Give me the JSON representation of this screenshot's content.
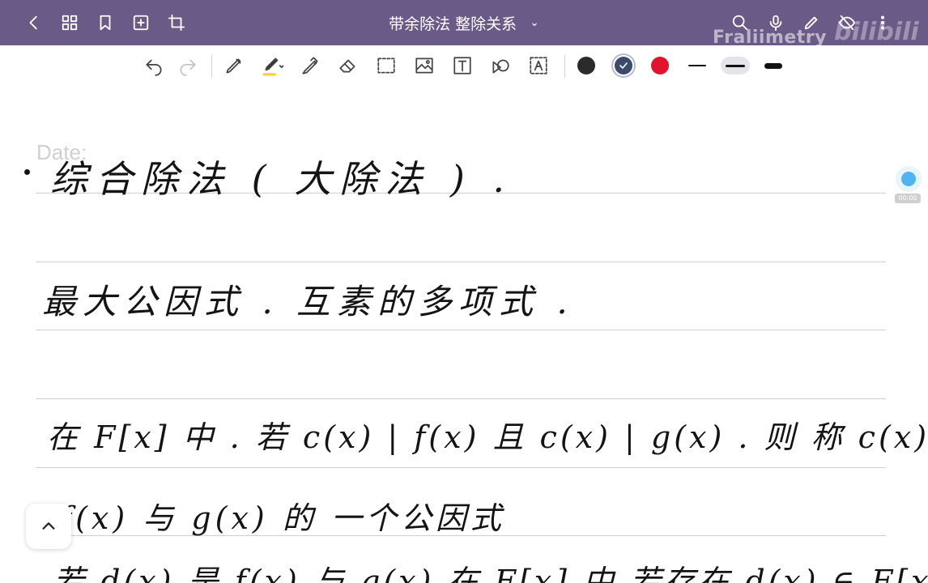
{
  "titlebar": {
    "title": "带余除法 整除关系",
    "chevron": "⌄",
    "watermark": "Fraliimetry",
    "watermark_logo": "bilibili",
    "left_icons": [
      "back-icon",
      "grid-icon",
      "bookmark-icon",
      "add-page-icon",
      "crop-icon"
    ],
    "right_icons": [
      "search-icon",
      "microphone-icon",
      "pen-edit-icon",
      "hide-icon",
      "more-icon"
    ]
  },
  "toolbar": {
    "tools": [
      "undo-icon",
      "redo-icon",
      "pen-icon",
      "highlighter-icon",
      "marker-icon",
      "eraser-icon",
      "lasso-select-icon",
      "image-icon",
      "text-icon",
      "shape-icon",
      "text-recognize-icon"
    ],
    "colors": [
      {
        "name": "black",
        "hex": "#2b2b2b",
        "selected": false
      },
      {
        "name": "navy",
        "hex": "#3b4a6b",
        "selected": true
      },
      {
        "name": "red",
        "hex": "#e0142c",
        "selected": false
      }
    ],
    "stroke_widths": [
      {
        "name": "thin",
        "selected": false
      },
      {
        "name": "medium",
        "selected": true
      },
      {
        "name": "thick",
        "selected": false
      }
    ]
  },
  "note": {
    "date_label": "Date:",
    "lines": [
      {
        "text": "综合除法 ( 大除法 ) ."
      },
      {
        "text": "最大公因式 . 互素的多项式 ."
      },
      {
        "text": "在 F[x] 中 . 若 c(x) | f(x) 且 c(x) | g(x) . 则 称 c(x) 是"
      },
      {
        "text": "f(x) 与 g(x) 的 一个公因式"
      },
      {
        "text": "若 d(x) 是 f(x) 与 g(x) 在 F[x] 中 若存在 d(x) ∈ F[x] 满足"
      }
    ]
  },
  "overlay": {
    "scroll_up_icon": "chevron-up-icon",
    "recording_time": "00:00"
  }
}
